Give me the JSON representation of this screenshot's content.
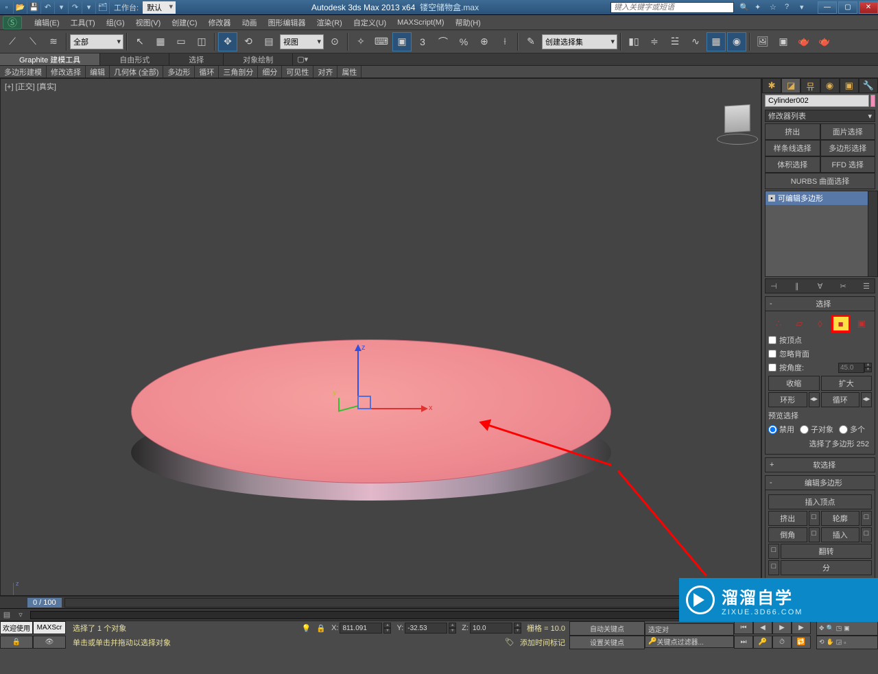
{
  "title": {
    "app": "Autodesk 3ds Max  2013 x64",
    "file": "镂空储物盒.max"
  },
  "workspace": {
    "label": "工作台:",
    "value": "默认"
  },
  "search": {
    "placeholder": "键入关键字或短语"
  },
  "menu": [
    "编辑(E)",
    "工具(T)",
    "组(G)",
    "视图(V)",
    "创建(C)",
    "修改器",
    "动画",
    "图形编辑器",
    "渲染(R)",
    "自定义(U)",
    "MAXScript(M)",
    "帮助(H)"
  ],
  "toolbar": {
    "sel_filter": "全部",
    "ref_sys": "视图",
    "snap_deg": "3",
    "create_set": "创建选择集"
  },
  "graphite": {
    "tabs": [
      "Graphite 建模工具",
      "自由形式",
      "选择",
      "对象绘制"
    ],
    "sub": [
      "多边形建模",
      "修改选择",
      "编辑",
      "几何体 (全部)",
      "多边形",
      "循环",
      "三角剖分",
      "细分",
      "可见性",
      "对齐",
      "属性"
    ]
  },
  "viewport": {
    "label": "[+] [正交] [真实]"
  },
  "panel": {
    "object_name": "Cylinder002",
    "mod_list": "修改器列表",
    "mod_btns": [
      "挤出",
      "面片选择",
      "样条线选择",
      "多边形选择",
      "体积选择",
      "FFD 选择",
      "NURBS 曲面选择"
    ],
    "stack_item": "可编辑多边形",
    "roll_sel": "选择",
    "chk_vertex": "按顶点",
    "chk_backface": "忽略背面",
    "chk_angle": "按角度:",
    "angle": "45.0",
    "shrink": "收缩",
    "grow": "扩大",
    "ring": "环形",
    "loop": "循环",
    "preview": "预览选择",
    "r_none": "禁用",
    "r_sub": "子对象",
    "r_multi": "多个",
    "count": "选择了多边形 252",
    "roll_soft": "软选择",
    "roll_edit": "编辑多边形",
    "insert_v": "插入顶点",
    "extrude": "挤出",
    "outline": "轮廓",
    "bevel": "倒角",
    "inset": "插入",
    "flip": "翻转"
  },
  "time": {
    "cur": "0 / 100"
  },
  "status": {
    "welcome": "欢迎使用",
    "script": "MAXScr",
    "sel": "选择了 1 个对象",
    "hint": "单击或单击并拖动以选择对象",
    "x": "811.091",
    "y": "-32.53",
    "z": "10.0",
    "grid": "栅格 = 10.0",
    "autok": "自动关键点",
    "setk": "设置关键点",
    "seldrop": "选定对",
    "filter": "关键点过滤器...",
    "addmark": "添加时间标记"
  },
  "watermark": {
    "t1": "溜溜自学",
    "t2": "ZIXUE.3D66.COM"
  }
}
